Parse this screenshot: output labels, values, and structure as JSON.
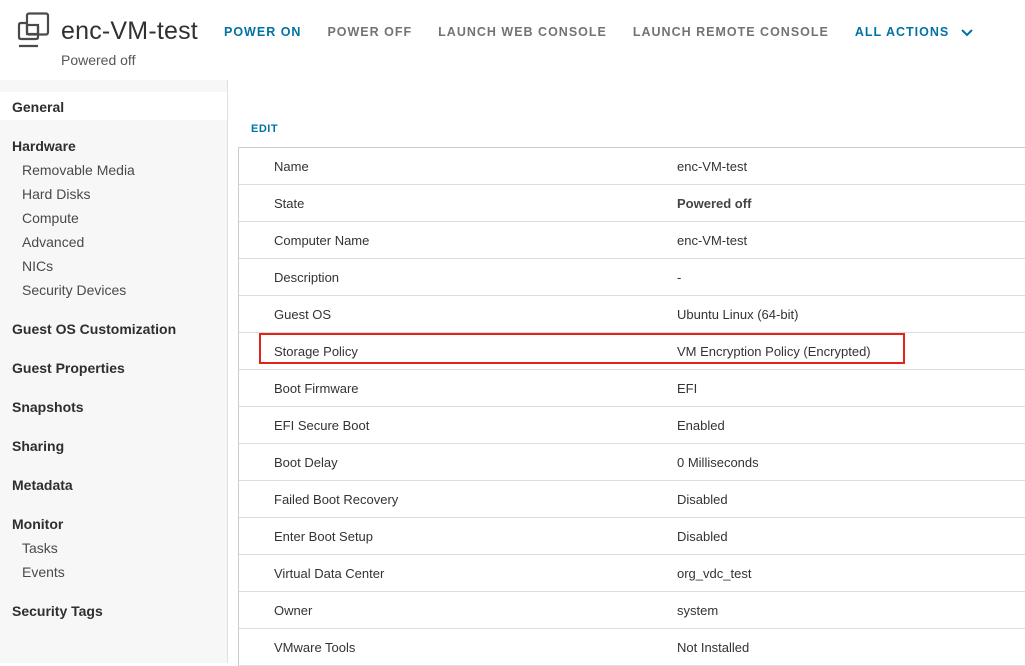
{
  "header": {
    "vm_name": "enc-VM-test",
    "vm_state": "Powered off",
    "actions": [
      {
        "label": "POWER ON",
        "style": "primary"
      },
      {
        "label": "POWER OFF",
        "style": "muted"
      },
      {
        "label": "LAUNCH WEB CONSOLE",
        "style": "muted"
      },
      {
        "label": "LAUNCH REMOTE CONSOLE",
        "style": "muted"
      },
      {
        "label": "ALL ACTIONS",
        "style": "primary",
        "icon": "chevron-down-icon"
      }
    ]
  },
  "sidebar": {
    "general": "General",
    "hardware": "Hardware",
    "hardware_items": [
      "Removable Media",
      "Hard Disks",
      "Compute",
      "Advanced",
      "NICs",
      "Security Devices"
    ],
    "guest_os_customization": "Guest OS Customization",
    "guest_properties": "Guest Properties",
    "snapshots": "Snapshots",
    "sharing": "Sharing",
    "metadata": "Metadata",
    "monitor": "Monitor",
    "monitor_items": [
      "Tasks",
      "Events"
    ],
    "security_tags": "Security Tags"
  },
  "main": {
    "edit_label": "EDIT",
    "properties": [
      {
        "label": "Name",
        "value": "enc-VM-test"
      },
      {
        "label": "State",
        "value": "Powered off"
      },
      {
        "label": "Computer Name",
        "value": "enc-VM-test"
      },
      {
        "label": "Description",
        "value": "-"
      },
      {
        "label": "Guest OS",
        "value": "Ubuntu Linux (64-bit)"
      },
      {
        "label": "Storage Policy",
        "value": "VM Encryption Policy (Encrypted)"
      },
      {
        "label": "Boot Firmware",
        "value": "EFI"
      },
      {
        "label": "EFI Secure Boot",
        "value": "Enabled"
      },
      {
        "label": "Boot Delay",
        "value": "0 Milliseconds"
      },
      {
        "label": "Failed Boot Recovery",
        "value": "Disabled"
      },
      {
        "label": "Enter Boot Setup",
        "value": "Disabled"
      },
      {
        "label": "Virtual Data Center",
        "value": "org_vdc_test"
      },
      {
        "label": "Owner",
        "value": "system"
      },
      {
        "label": "VMware Tools",
        "value": "Not Installed"
      }
    ]
  },
  "colors": {
    "accent": "#0072a3",
    "muted_action": "#737373",
    "highlight": "#e2231a",
    "sidebar_bg": "#f7f7f7"
  }
}
